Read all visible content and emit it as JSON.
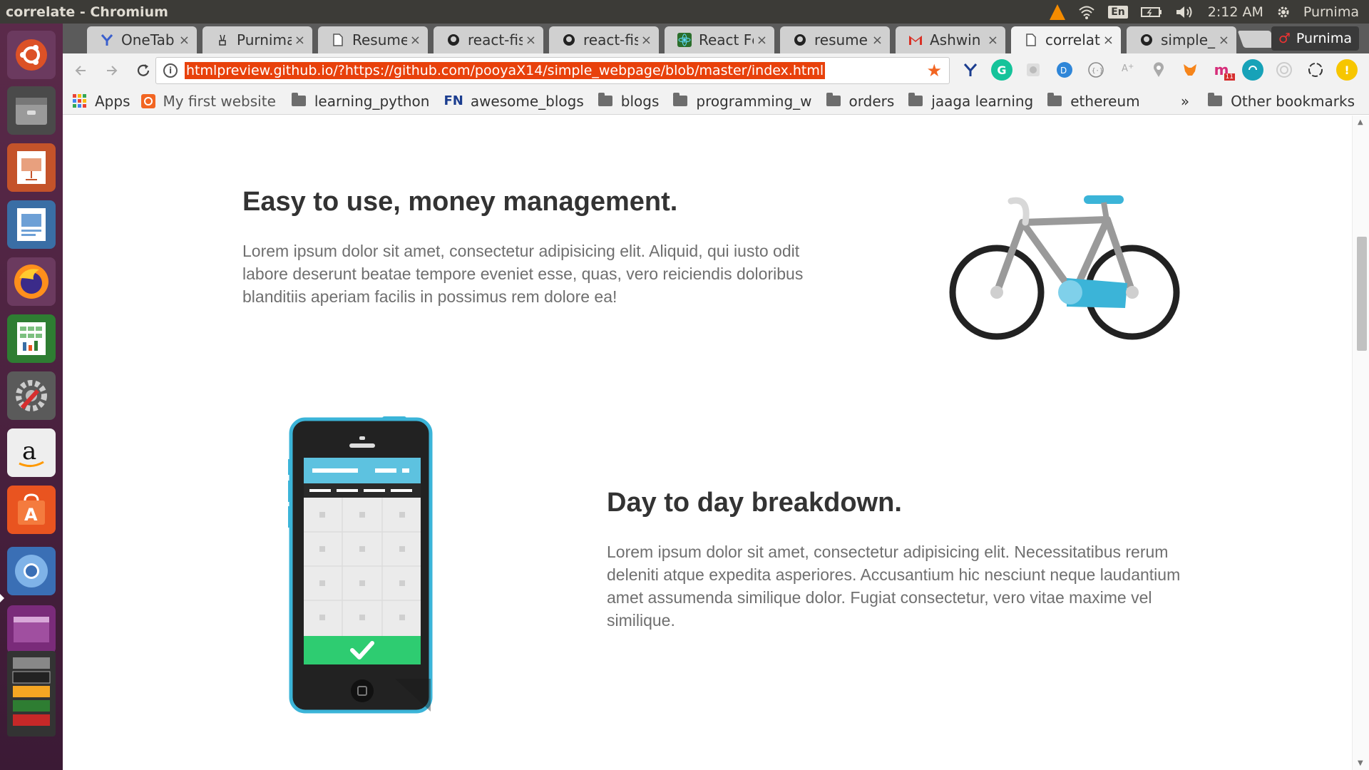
{
  "window": {
    "title": "correlate - Chromium"
  },
  "tray": {
    "keyboard": "En",
    "time": "2:12 AM",
    "user": "Purnima"
  },
  "tabs": [
    {
      "label": "OneTab",
      "icon": "onetab-icon"
    },
    {
      "label": "Purnima",
      "icon": "peace-icon"
    },
    {
      "label": "Resume",
      "icon": "document-icon"
    },
    {
      "label": "react-fis",
      "icon": "github-icon"
    },
    {
      "label": "react-fis",
      "icon": "github-icon"
    },
    {
      "label": "React Fc",
      "icon": "react-icon"
    },
    {
      "label": "resume",
      "icon": "github-icon"
    },
    {
      "label": "Ashwin",
      "icon": "gmail-icon"
    },
    {
      "label": "correlat",
      "icon": "document-icon",
      "active": true
    },
    {
      "label": "simple_",
      "icon": "github-icon"
    }
  ],
  "tab_close": "×",
  "profile": {
    "name": "Purnima"
  },
  "toolbar": {
    "url": "htmlpreview.github.io/?https://github.com/pooyaX14/simple_webpage/blob/master/index.html",
    "info": "i",
    "ext_badge": "11"
  },
  "bookmarks": {
    "apps": "Apps",
    "items": [
      "My first website",
      "learning_python",
      "awesome_blogs",
      "blogs",
      "programming_w",
      "orders",
      "jaaga learning",
      "ethereum"
    ],
    "more": "»",
    "other": "Other bookmarks"
  },
  "features": [
    {
      "title": "Easy to use, money management.",
      "text": "Lorem ipsum dolor sit amet, consectetur adipisicing elit. Aliquid, qui iusto odit labore deserunt beatae tempore eveniet esse, quas, vero reiciendis doloribus blanditiis aperiam facilis in possimus rem dolore ea!"
    },
    {
      "title": "Day to day breakdown.",
      "text": "Lorem ipsum dolor sit amet, consectetur adipisicing elit. Necessitatibus rerum deleniti atque expedita asperiores. Accusantium hic nesciunt neque laudantium amet assumenda similique dolor. Fugiat consectetur, vero vitae maxime vel similique."
    }
  ],
  "colors": {
    "accent": "#3bb4d8",
    "check_green": "#2ecc71",
    "url_highlight": "#e8410b"
  }
}
